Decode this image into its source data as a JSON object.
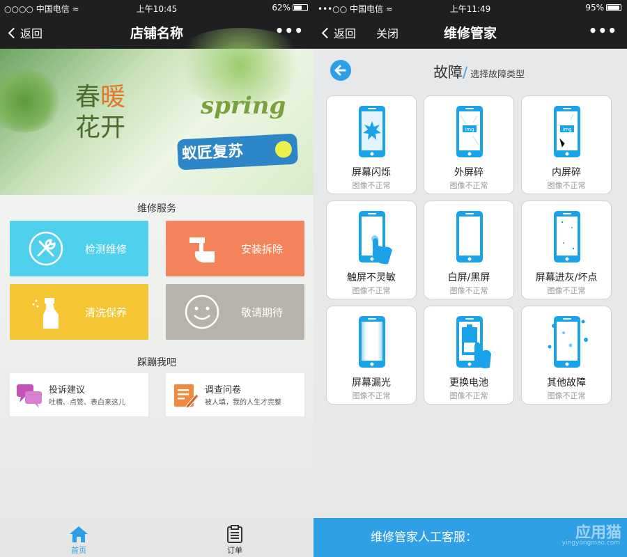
{
  "left": {
    "status": {
      "carrier": "○○○○ 中国电信 ≈",
      "time": "上午10:45",
      "battery": "62%",
      "battery_level": 0.62
    },
    "nav": {
      "back_label": "返回",
      "title": "店铺名称",
      "more": "•••"
    },
    "banner": {
      "line1a": "春",
      "line1b": "暖",
      "line2": "花开",
      "spring": "spring",
      "tag": "蚁匠复苏"
    },
    "services_title": "维修服务",
    "tiles": [
      {
        "label": "检测维修",
        "color": "#4fd0ec",
        "icon": "tools-icon"
      },
      {
        "label": "安装拆除",
        "color": "#f3845c",
        "icon": "hammer-icon"
      },
      {
        "label": "清洗保养",
        "color": "#f6c534",
        "icon": "spray-bottle-icon"
      },
      {
        "label": "敬请期待",
        "color": "#b8b2ad",
        "icon": "smiley-icon"
      }
    ],
    "feedback_title": "踩蹦我吧",
    "cards": [
      {
        "title": "投诉建议",
        "subtitle": "吐槽、点赞、表白来这儿",
        "icon": "chat-bubbles-icon",
        "color": "#c254b8"
      },
      {
        "title": "调查问卷",
        "subtitle": "被人填，我的人生才完整",
        "icon": "survey-edit-icon",
        "color": "#f08a40"
      }
    ],
    "tabs": [
      {
        "label": "首页",
        "icon": "home-icon",
        "active": true
      },
      {
        "label": "订单",
        "icon": "clipboard-icon",
        "active": false
      }
    ],
    "accent": "#2d9fe6"
  },
  "right": {
    "status": {
      "carrier": "•••○○ 中国电信 ≈",
      "time": "上午11:49",
      "battery": "95%",
      "battery_level": 0.95
    },
    "nav": {
      "back_label": "返回",
      "close_label": "关闭",
      "title": "维修管家",
      "more": "•••"
    },
    "header": {
      "title": "故障",
      "slash": "/",
      "subtitle": "选择故障类型"
    },
    "faults": [
      {
        "name": "屏幕闪烁",
        "desc": "图像不正常",
        "icon": "screen-flicker-icon"
      },
      {
        "name": "外屏碎",
        "desc": "图像不正常",
        "icon": "cracked-outer-screen-icon",
        "screen_text": "img"
      },
      {
        "name": "内屏碎",
        "desc": "图像不正常",
        "icon": "cracked-inner-screen-icon",
        "screen_text": "img"
      },
      {
        "name": "触屏不灵敏",
        "desc": "图像不正常",
        "icon": "touch-screen-icon"
      },
      {
        "name": "白屏/黑屏",
        "desc": "图像不正常",
        "icon": "blank-screen-icon"
      },
      {
        "name": "屏幕进灰/坏点",
        "desc": "图像不正常",
        "icon": "dust-dead-pixel-icon"
      },
      {
        "name": "屏幕漏光",
        "desc": "图像不正常",
        "icon": "light-leak-icon"
      },
      {
        "name": "更换电池",
        "desc": "图像不正常",
        "icon": "battery-replace-icon"
      },
      {
        "name": "其他故障",
        "desc": "图像不正常",
        "icon": "water-damage-icon"
      }
    ],
    "hotline": "维修管家人工客服：",
    "watermark": "应用猫",
    "watermark_small": "yingyongmao.com",
    "phone_color": "#1aa3e8"
  }
}
